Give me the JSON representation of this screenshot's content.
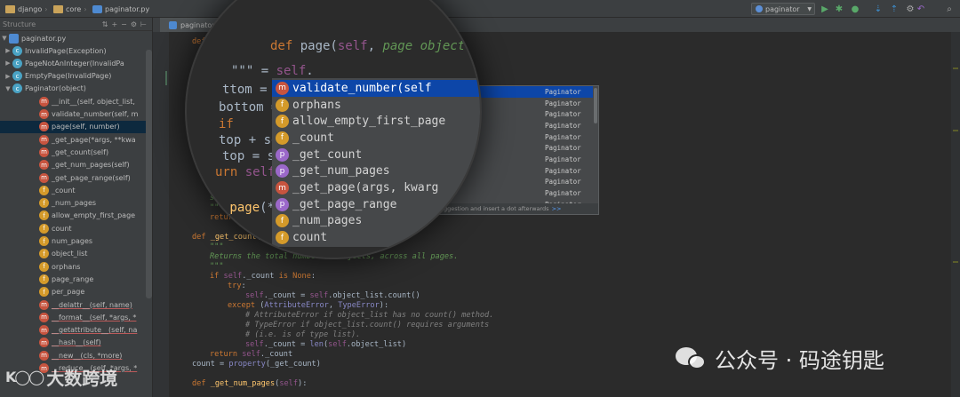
{
  "navbar": {
    "crumbs": [
      "django",
      "core",
      "paginator.py"
    ],
    "run_config": "paginator"
  },
  "structure": {
    "title": "Structure",
    "root": "paginator.py",
    "items": [
      {
        "kind": "c",
        "label": "InvalidPage(Exception)",
        "arrow": "▶",
        "indent": 1
      },
      {
        "kind": "c",
        "label": "PageNotAnInteger(InvalidPa",
        "arrow": "▶",
        "indent": 1
      },
      {
        "kind": "c",
        "label": "EmptyPage(InvalidPage)",
        "arrow": "▶",
        "indent": 1
      },
      {
        "kind": "c",
        "label": "Paginator(object)",
        "arrow": "▼",
        "indent": 1
      },
      {
        "kind": "m",
        "label": "__init__(self, object_list,",
        "indent": 2
      },
      {
        "kind": "m",
        "label": "validate_number(self, m",
        "indent": 2
      },
      {
        "kind": "m",
        "label": "page(self, number)",
        "indent": 2,
        "selected": true
      },
      {
        "kind": "m",
        "label": "_get_page(*args, **kwa",
        "indent": 2
      },
      {
        "kind": "m",
        "label": "_get_count(self)",
        "indent": 2
      },
      {
        "kind": "m",
        "label": "_get_num_pages(self)",
        "indent": 2
      },
      {
        "kind": "m",
        "label": "_get_page_range(self)",
        "indent": 2
      },
      {
        "kind": "f",
        "label": "_count",
        "indent": 2
      },
      {
        "kind": "f",
        "label": "_num_pages",
        "indent": 2
      },
      {
        "kind": "f",
        "label": "allow_empty_first_page",
        "indent": 2
      },
      {
        "kind": "f",
        "label": "count",
        "indent": 2
      },
      {
        "kind": "f",
        "label": "num_pages",
        "indent": 2
      },
      {
        "kind": "f",
        "label": "object_list",
        "indent": 2
      },
      {
        "kind": "f",
        "label": "orphans",
        "indent": 2
      },
      {
        "kind": "f",
        "label": "page_range",
        "indent": 2
      },
      {
        "kind": "f",
        "label": "per_page",
        "indent": 2
      },
      {
        "kind": "m",
        "label": "__delattr__(self, name)",
        "indent": 2,
        "strike": true
      },
      {
        "kind": "m",
        "label": "__format__(self, *args, *",
        "indent": 2,
        "strike": true
      },
      {
        "kind": "m",
        "label": "__getattribute__(self, na",
        "indent": 2,
        "strike": true
      },
      {
        "kind": "m",
        "label": "__hash__(self)",
        "indent": 2,
        "strike": true
      },
      {
        "kind": "m",
        "label": "__new__(cls, *more)",
        "indent": 2,
        "strike": true
      },
      {
        "kind": "m",
        "label": "__reduce__(self, *args, *",
        "indent": 2,
        "strike": true
      }
    ]
  },
  "editor": {
    "tab": "paginator.py",
    "completion": {
      "items": [
        {
          "kind": "m",
          "name": "validate_number(self",
          "type": "Paginator",
          "selected": true
        },
        {
          "kind": "f",
          "name": "orphans",
          "type": "Paginator"
        },
        {
          "kind": "f",
          "name": "allow_empty_first_page",
          "type": "Paginator"
        },
        {
          "kind": "f",
          "name": "_count",
          "type": "Paginator"
        },
        {
          "kind": "p",
          "name": "_get_count",
          "type": "Paginator"
        },
        {
          "kind": "p",
          "name": "_get_num_pages",
          "type": "Paginator"
        },
        {
          "kind": "m",
          "name": "_get_page(args, kwarg",
          "type": "Paginator"
        },
        {
          "kind": "p",
          "name": "_get_page_range",
          "type": "Paginator"
        },
        {
          "kind": "f",
          "name": "_num_pages",
          "type": "Paginator"
        },
        {
          "kind": "f",
          "name": "count",
          "type": "Paginator"
        },
        {
          "kind": "f",
          "name": "",
          "type": "Paginator"
        }
      ],
      "hint": "ggestion and insert a dot afterwards",
      "hint_link": ">>"
    }
  },
  "watermarks": {
    "left": "大数跨境",
    "left_logo": "K◯◯",
    "right": "公众号 · 码途钥匙"
  }
}
